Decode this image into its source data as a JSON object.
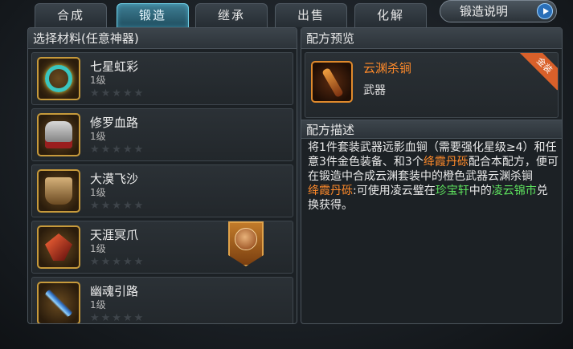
{
  "tabs": [
    {
      "label": "合成",
      "active": false
    },
    {
      "label": "锻造",
      "active": true
    },
    {
      "label": "继承",
      "active": false
    },
    {
      "label": "出售",
      "active": false
    },
    {
      "label": "化解",
      "active": false
    }
  ],
  "guide_button": {
    "label": "锻造说明"
  },
  "materials": {
    "title": "选择材料(任意神器)",
    "items": [
      {
        "name": "七星虹彩",
        "level": "1级",
        "stars": "★★★★★",
        "icon": "rainbow-ring-icon",
        "icon_color": "#3ac6c0"
      },
      {
        "name": "修罗血路",
        "level": "1级",
        "stars": "★★★★★",
        "icon": "armor-icon",
        "icon_color": "#c8c8c8"
      },
      {
        "name": "大漠飞沙",
        "level": "1级",
        "stars": "★★★★★",
        "icon": "cloak-icon",
        "icon_color": "#b08a55"
      },
      {
        "name": "天涯冥爪",
        "level": "1级",
        "stars": "★★★★★",
        "icon": "claw-icon",
        "icon_color": "#d03a2a"
      },
      {
        "name": "幽魂引路",
        "level": "1级",
        "stars": "★★★★★",
        "icon": "spears-icon",
        "icon_color": "#4aa6ff"
      }
    ]
  },
  "preview": {
    "title": "配方预览",
    "item_name": "云渊杀锏",
    "item_type": "武器",
    "ribbon": "金装",
    "icon": "mace-icon"
  },
  "description": {
    "title": "配方描述",
    "t1": "将1件套装武器远影血锏（需要强化星级≥4）和任意3件金色装备、和3个",
    "t2": "绛霞丹砾",
    "t3": "配合本配方，便可在锻造中合成云渊套装中的橙色武器云渊杀锏",
    "t4": "绛霞丹砾",
    "t5": ":可使用凌云璧在",
    "t6": "珍宝轩",
    "t7": "中的",
    "t8": "凌云锦市",
    "t9": "兑换获得。"
  },
  "colors": {
    "accent": "#6fd0e8",
    "orange": "#ff8a2a",
    "green": "#5ee35e"
  }
}
